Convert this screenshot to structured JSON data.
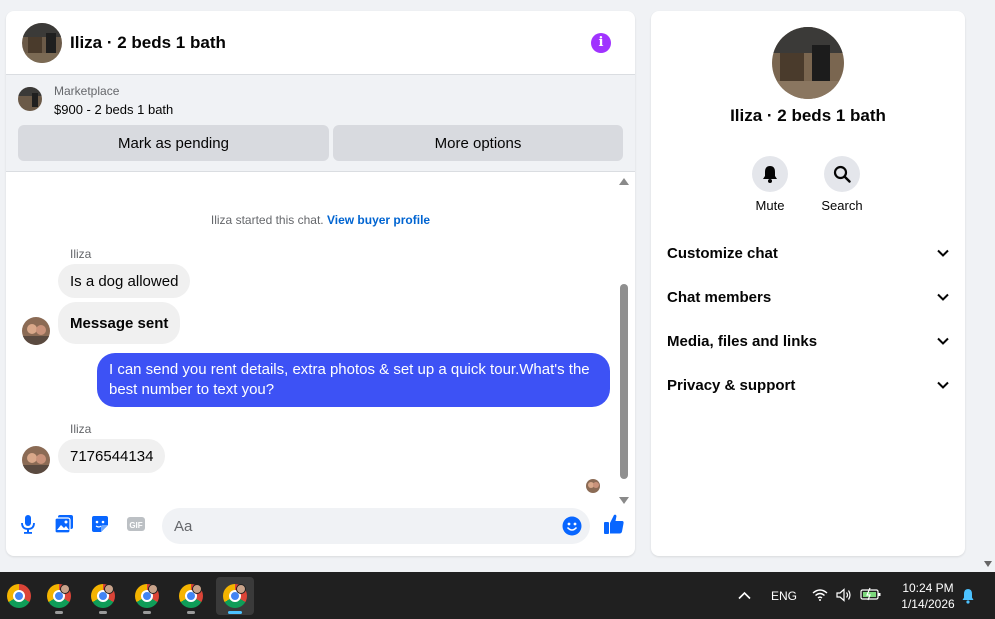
{
  "chat": {
    "title": "Iliza · 2 beds 1 bath",
    "listing": {
      "source": "Marketplace",
      "price_title": "$900 - 2 beds 1 bath",
      "mark_pending_label": "Mark as pending",
      "more_options_label": "More options"
    },
    "system_message": "Iliza started this chat.",
    "view_profile_label": "View buyer profile",
    "messages": [
      {
        "sender": "Iliza",
        "text": "Is a dog allowed"
      },
      {
        "text": "Message sent"
      },
      {
        "text": "I can send you rent details, extra photos & set up a quick tour.What's the best number to text you?"
      },
      {
        "sender": "Iliza",
        "text": "7176544134"
      }
    ],
    "composer_placeholder": "Aa",
    "colors": {
      "outgoing": "#3d52f5",
      "accent": "#a033ff",
      "link": "#0064d1"
    }
  },
  "info_panel": {
    "title": "Iliza · 2 beds 1 bath",
    "mute_label": "Mute",
    "search_label": "Search",
    "sections": [
      "Customize chat",
      "Chat members",
      "Media, files and links",
      "Privacy & support"
    ]
  },
  "taskbar": {
    "language": "ENG",
    "time": "10:24 PM",
    "date": "1/14/2026"
  }
}
